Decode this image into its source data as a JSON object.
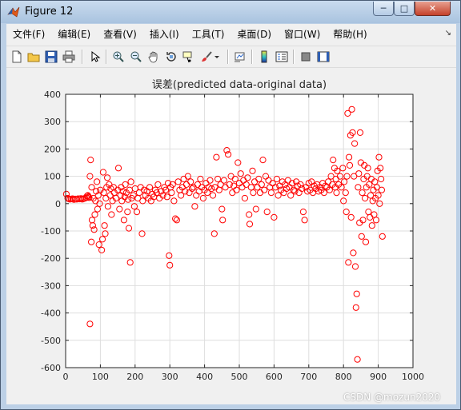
{
  "window": {
    "title": "Figure 12",
    "buttons": {
      "minimize": "─",
      "maximize": "□",
      "close": "✕"
    }
  },
  "menu": {
    "items": [
      "文件(F)",
      "编辑(E)",
      "查看(V)",
      "插入(I)",
      "工具(T)",
      "桌面(D)",
      "窗口(W)",
      "帮助(H)"
    ],
    "overflow": "↘"
  },
  "toolbar": {
    "icons": [
      "new-figure-icon",
      "open-file-icon",
      "save-icon",
      "print-icon",
      "edit-plot-arrow-icon",
      "zoom-in-icon",
      "zoom-out-icon",
      "pan-hand-icon",
      "rotate-3d-icon",
      "data-cursor-icon",
      "brush-icon",
      "brush-dropdown-icon",
      "link-plot-icon",
      "insert-colorbar-icon",
      "insert-legend-icon",
      "hide-plot-tools-icon",
      "show-plot-tools-icon"
    ]
  },
  "watermark": "CSDN @mozun2020",
  "chart_data": {
    "type": "scatter",
    "title": "误差(predicted data-original data)",
    "xlabel": "",
    "ylabel": "",
    "xlim": [
      0,
      1000
    ],
    "ylim": [
      -600,
      400
    ],
    "xticks": [
      0,
      100,
      200,
      300,
      400,
      500,
      600,
      700,
      800,
      900,
      1000
    ],
    "yticks": [
      400,
      300,
      200,
      100,
      0,
      -100,
      -200,
      -300,
      -400,
      -500,
      -600
    ],
    "grid": true,
    "marker": "open-circle",
    "color": "#ff0000",
    "series": [
      {
        "values": [
          [
            2,
            35
          ],
          [
            6,
            20
          ],
          [
            8,
            18
          ],
          [
            12,
            16
          ],
          [
            16,
            17
          ],
          [
            20,
            18
          ],
          [
            24,
            15
          ],
          [
            28,
            17
          ],
          [
            32,
            16
          ],
          [
            36,
            18
          ],
          [
            40,
            17
          ],
          [
            44,
            19
          ],
          [
            48,
            16
          ],
          [
            52,
            18
          ],
          [
            56,
            20
          ],
          [
            60,
            22
          ],
          [
            62,
            28
          ],
          [
            64,
            30
          ],
          [
            66,
            25
          ],
          [
            68,
            22
          ],
          [
            70,
            -440
          ],
          [
            70,
            100
          ],
          [
            72,
            160
          ],
          [
            74,
            -140
          ],
          [
            75,
            60
          ],
          [
            76,
            -60
          ],
          [
            78,
            -80
          ],
          [
            80,
            20
          ],
          [
            82,
            -95
          ],
          [
            84,
            -40
          ],
          [
            86,
            10
          ],
          [
            88,
            45
          ],
          [
            90,
            80
          ],
          [
            92,
            -20
          ],
          [
            94,
            30
          ],
          [
            96,
            -150
          ],
          [
            98,
            0
          ],
          [
            100,
            50
          ],
          [
            104,
            -170
          ],
          [
            106,
            -130
          ],
          [
            108,
            115
          ],
          [
            110,
            40
          ],
          [
            112,
            -80
          ],
          [
            114,
            -110
          ],
          [
            116,
            20
          ],
          [
            118,
            60
          ],
          [
            120,
            95
          ],
          [
            122,
            -10
          ],
          [
            125,
            70
          ],
          [
            128,
            30
          ],
          [
            130,
            55
          ],
          [
            132,
            -40
          ],
          [
            135,
            10
          ],
          [
            138,
            60
          ],
          [
            140,
            40
          ],
          [
            145,
            20
          ],
          [
            150,
            50
          ],
          [
            152,
            130
          ],
          [
            155,
            -20
          ],
          [
            158,
            30
          ],
          [
            160,
            60
          ],
          [
            162,
            10
          ],
          [
            165,
            45
          ],
          [
            168,
            -60
          ],
          [
            170,
            25
          ],
          [
            172,
            70
          ],
          [
            175,
            40
          ],
          [
            178,
            -30
          ],
          [
            180,
            15
          ],
          [
            182,
            -90
          ],
          [
            184,
            50
          ],
          [
            186,
            -215
          ],
          [
            188,
            80
          ],
          [
            190,
            20
          ],
          [
            195,
            30
          ],
          [
            198,
            -10
          ],
          [
            200,
            55
          ],
          [
            205,
            -30
          ],
          [
            208,
            20
          ],
          [
            212,
            40
          ],
          [
            216,
            60
          ],
          [
            220,
            -110
          ],
          [
            222,
            10
          ],
          [
            226,
            50
          ],
          [
            230,
            30
          ],
          [
            234,
            45
          ],
          [
            238,
            20
          ],
          [
            242,
            60
          ],
          [
            246,
            10
          ],
          [
            250,
            35
          ],
          [
            254,
            25
          ],
          [
            258,
            50
          ],
          [
            262,
            40
          ],
          [
            266,
            70
          ],
          [
            270,
            20
          ],
          [
            275,
            45
          ],
          [
            280,
            30
          ],
          [
            284,
            60
          ],
          [
            288,
            50
          ],
          [
            292,
            25
          ],
          [
            295,
            75
          ],
          [
            298,
            -190
          ],
          [
            300,
            -225
          ],
          [
            302,
            60
          ],
          [
            305,
            40
          ],
          [
            308,
            70
          ],
          [
            312,
            10
          ],
          [
            316,
            -55
          ],
          [
            320,
            -60
          ],
          [
            324,
            80
          ],
          [
            328,
            50
          ],
          [
            332,
            30
          ],
          [
            336,
            60
          ],
          [
            340,
            90
          ],
          [
            344,
            45
          ],
          [
            348,
            70
          ],
          [
            352,
            100
          ],
          [
            356,
            40
          ],
          [
            360,
            80
          ],
          [
            364,
            55
          ],
          [
            368,
            60
          ],
          [
            372,
            -10
          ],
          [
            376,
            30
          ],
          [
            380,
            70
          ],
          [
            384,
            45
          ],
          [
            388,
            90
          ],
          [
            392,
            60
          ],
          [
            396,
            20
          ],
          [
            400,
            50
          ],
          [
            404,
            75
          ],
          [
            408,
            40
          ],
          [
            412,
            60
          ],
          [
            416,
            85
          ],
          [
            420,
            55
          ],
          [
            424,
            30
          ],
          [
            428,
            -110
          ],
          [
            430,
            60
          ],
          [
            434,
            170
          ],
          [
            438,
            90
          ],
          [
            442,
            50
          ],
          [
            446,
            70
          ],
          [
            450,
            -20
          ],
          [
            452,
            -60
          ],
          [
            456,
            85
          ],
          [
            460,
            60
          ],
          [
            464,
            195
          ],
          [
            468,
            180
          ],
          [
            472,
            70
          ],
          [
            476,
            100
          ],
          [
            480,
            40
          ],
          [
            484,
            65
          ],
          [
            488,
            90
          ],
          [
            492,
            50
          ],
          [
            496,
            150
          ],
          [
            500,
            75
          ],
          [
            504,
            110
          ],
          [
            508,
            60
          ],
          [
            512,
            85
          ],
          [
            516,
            20
          ],
          [
            520,
            70
          ],
          [
            524,
            95
          ],
          [
            528,
            -40
          ],
          [
            530,
            -75
          ],
          [
            534,
            60
          ],
          [
            538,
            120
          ],
          [
            540,
            40
          ],
          [
            544,
            80
          ],
          [
            548,
            -20
          ],
          [
            552,
            60
          ],
          [
            556,
            90
          ],
          [
            560,
            40
          ],
          [
            564,
            70
          ],
          [
            568,
            160
          ],
          [
            572,
            50
          ],
          [
            576,
            100
          ],
          [
            580,
            -30
          ],
          [
            584,
            85
          ],
          [
            588,
            60
          ],
          [
            592,
            40
          ],
          [
            596,
            75
          ],
          [
            600,
            -50
          ],
          [
            604,
            60
          ],
          [
            608,
            90
          ],
          [
            612,
            30
          ],
          [
            616,
            65
          ],
          [
            620,
            50
          ],
          [
            624,
            80
          ],
          [
            628,
            40
          ],
          [
            632,
            70
          ],
          [
            636,
            55
          ],
          [
            640,
            85
          ],
          [
            644,
            60
          ],
          [
            648,
            30
          ],
          [
            652,
            75
          ],
          [
            656,
            50
          ],
          [
            660,
            45
          ],
          [
            664,
            80
          ],
          [
            668,
            65
          ],
          [
            672,
            40
          ],
          [
            676,
            70
          ],
          [
            680,
            55
          ],
          [
            684,
            -30
          ],
          [
            688,
            -60
          ],
          [
            692,
            60
          ],
          [
            696,
            45
          ],
          [
            700,
            75
          ],
          [
            704,
            50
          ],
          [
            708,
            80
          ],
          [
            712,
            40
          ],
          [
            716,
            65
          ],
          [
            720,
            55
          ],
          [
            724,
            70
          ],
          [
            728,
            45
          ],
          [
            732,
            60
          ],
          [
            736,
            50
          ],
          [
            740,
            75
          ],
          [
            744,
            40
          ],
          [
            748,
            65
          ],
          [
            752,
            60
          ],
          [
            756,
            80
          ],
          [
            760,
            50
          ],
          [
            764,
            100
          ],
          [
            768,
            70
          ],
          [
            770,
            160
          ],
          [
            774,
            130
          ],
          [
            776,
            60
          ],
          [
            778,
            90
          ],
          [
            780,
            40
          ],
          [
            782,
            120
          ],
          [
            786,
            70
          ],
          [
            790,
            100
          ],
          [
            794,
            60
          ],
          [
            798,
            130
          ],
          [
            800,
            10
          ],
          [
            802,
            80
          ],
          [
            806,
            40
          ],
          [
            808,
            -30
          ],
          [
            810,
            100
          ],
          [
            812,
            330
          ],
          [
            814,
            -215
          ],
          [
            816,
            170
          ],
          [
            818,
            140
          ],
          [
            820,
            250
          ],
          [
            822,
            -50
          ],
          [
            824,
            345
          ],
          [
            826,
            260
          ],
          [
            828,
            -180
          ],
          [
            830,
            100
          ],
          [
            832,
            220
          ],
          [
            834,
            -230
          ],
          [
            836,
            -380
          ],
          [
            838,
            -330
          ],
          [
            840,
            -570
          ],
          [
            842,
            60
          ],
          [
            844,
            110
          ],
          [
            846,
            -70
          ],
          [
            848,
            260
          ],
          [
            850,
            150
          ],
          [
            852,
            -120
          ],
          [
            854,
            40
          ],
          [
            856,
            -60
          ],
          [
            858,
            90
          ],
          [
            860,
            140
          ],
          [
            862,
            20
          ],
          [
            864,
            -140
          ],
          [
            866,
            60
          ],
          [
            868,
            100
          ],
          [
            870,
            130
          ],
          [
            872,
            -30
          ],
          [
            874,
            70
          ],
          [
            876,
            -50
          ],
          [
            878,
            30
          ],
          [
            880,
            90
          ],
          [
            882,
            -80
          ],
          [
            884,
            10
          ],
          [
            886,
            50
          ],
          [
            888,
            -40
          ],
          [
            890,
            80
          ],
          [
            892,
            20
          ],
          [
            894,
            -60
          ],
          [
            896,
            60
          ],
          [
            898,
            120
          ],
          [
            900,
            30
          ],
          [
            902,
            170
          ],
          [
            904,
            0
          ],
          [
            906,
            130
          ],
          [
            908,
            90
          ],
          [
            910,
            50
          ],
          [
            912,
            -120
          ]
        ]
      }
    ]
  }
}
